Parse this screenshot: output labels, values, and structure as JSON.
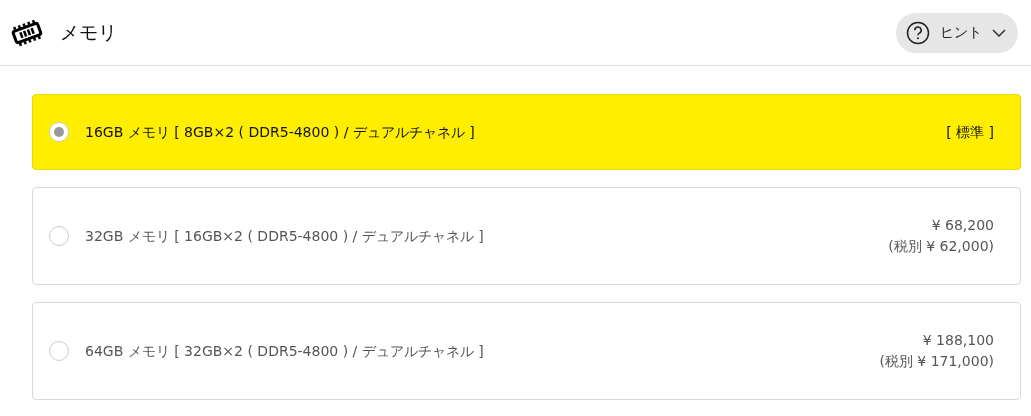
{
  "header": {
    "title": "メモリ",
    "hint_button": "ヒント"
  },
  "options": [
    {
      "label": "16GB メモリ [ 8GB×2 ( DDR5-4800 ) / デュアルチャネル ]",
      "selected": true,
      "price_lines": [
        "[ 標準 ]"
      ]
    },
    {
      "label": "32GB メモリ [ 16GB×2 ( DDR5-4800 ) / デュアルチャネル ]",
      "selected": false,
      "price_lines": [
        "¥ 68,200",
        "(税別 ¥ 62,000)"
      ]
    },
    {
      "label": "64GB メモリ [ 32GB×2 ( DDR5-4800 ) / デュアルチャネル ]",
      "selected": false,
      "price_lines": [
        "¥ 188,100",
        "(税別 ¥ 171,000)"
      ]
    }
  ]
}
